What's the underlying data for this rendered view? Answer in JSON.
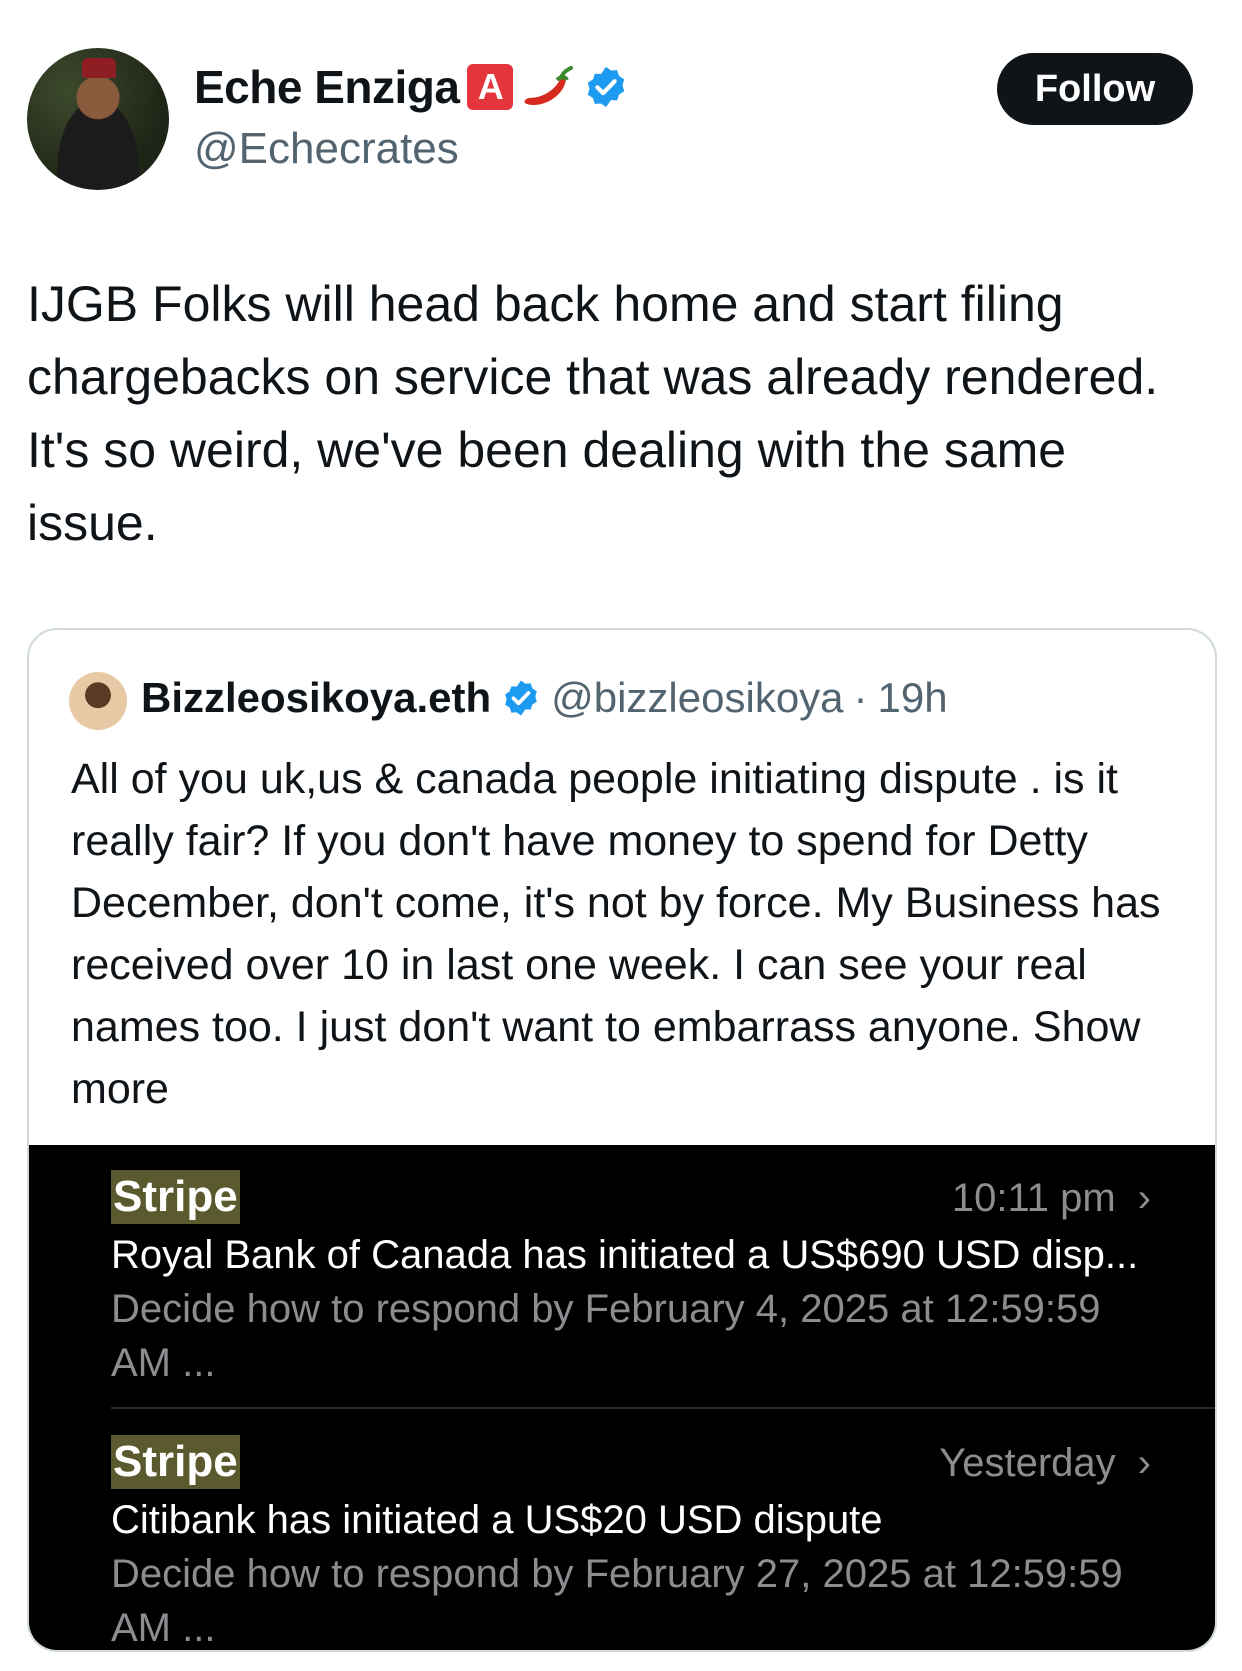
{
  "tweet": {
    "author_name": "Eche Enziga",
    "author_badge_letter": "A",
    "author_handle": "@Echecrates",
    "follow_label": "Follow",
    "text": "IJGB Folks will head back home and start filing chargebacks on service that was already rendered. It's so weird, we've been dealing with the same issue.",
    "icons": [
      "a-button-icon",
      "chili-pepper-icon",
      "verified-badge-icon"
    ]
  },
  "quoted_tweet": {
    "author_name": "Bizzleosikoya.eth",
    "author_handle": "@bizzleosikoya",
    "separator": "·",
    "time": "19h",
    "text": "All of you uk,us & canada people initiating dispute . is it really fair? If you don't have money to spend for Detty December, don't come, it's not by force. My Business has received over 10  in last one week. I can see your real names too. I just don't want to embarrass anyone.",
    "show_more": "Show more",
    "notifications": [
      {
        "sender": "Stripe",
        "time": "10:11 pm",
        "title": "Royal Bank of Canada has initiated a US$690 USD disp...",
        "body": "Decide how to respond by February 4, 2025 at 12:59:59 AM ..."
      },
      {
        "sender": "Stripe",
        "time": "Yesterday",
        "title": "Citibank has initiated a US$20 USD dispute",
        "body": "Decide how to respond by February 27, 2025 at 12:59:59 AM ..."
      }
    ]
  },
  "colors": {
    "follow_bg": "#0f1419",
    "verified_blue": "#1d9bf0",
    "badge_red": "#e3353b",
    "stripe_highlight": "#5b5a2e",
    "secondary_text": "#536471"
  }
}
